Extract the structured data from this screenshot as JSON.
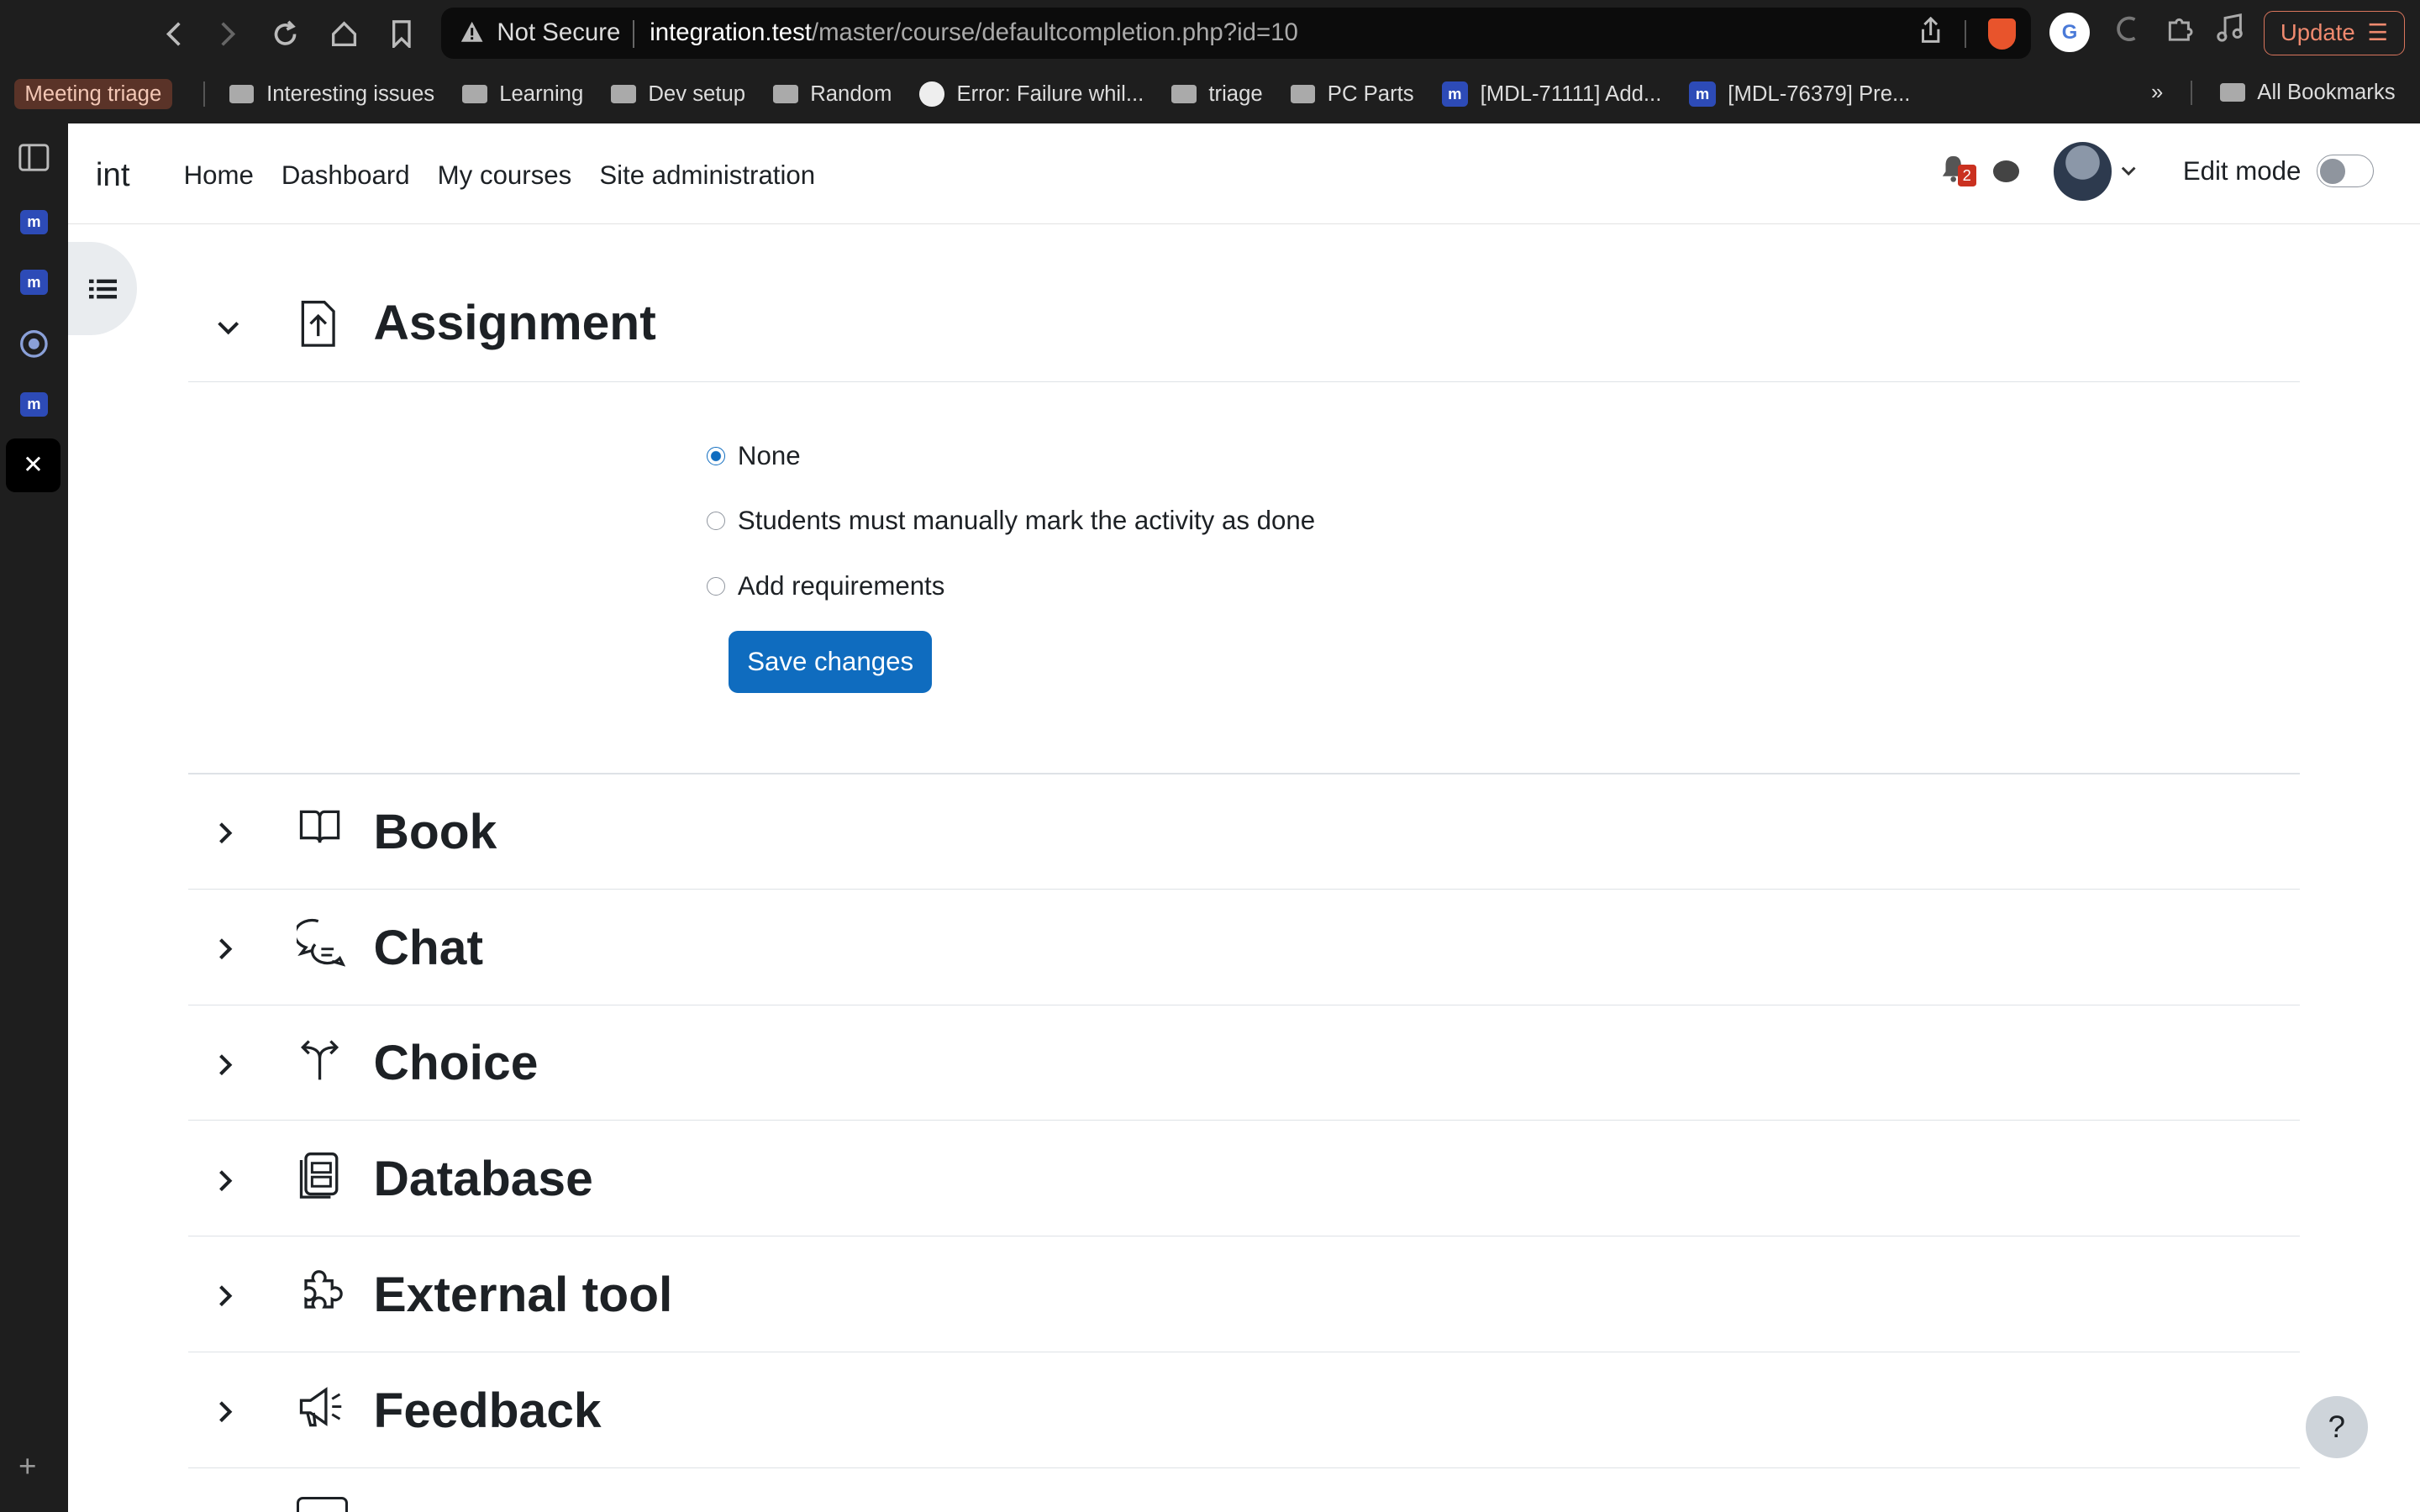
{
  "browser": {
    "url_warning": "Not Secure",
    "url_host": "integration.test",
    "url_path": "/master/course/defaultcompletion.php?id=10",
    "update_label": "Update"
  },
  "bookmarks": {
    "meeting": "Meeting triage",
    "items": [
      {
        "label": "Interesting issues",
        "icon": "folder-icon"
      },
      {
        "label": "Learning",
        "icon": "folder-icon"
      },
      {
        "label": "Dev setup",
        "icon": "folder-icon"
      },
      {
        "label": "Random",
        "icon": "folder-icon"
      },
      {
        "label": "Error: Failure whil...",
        "icon": "github-icon"
      },
      {
        "label": "triage",
        "icon": "folder-icon"
      },
      {
        "label": "PC Parts",
        "icon": "folder-icon"
      },
      {
        "label": "[MDL-71111] Add...",
        "icon": "moodle-icon"
      },
      {
        "label": "[MDL-76379] Pre...",
        "icon": "moodle-icon"
      }
    ],
    "overflow": "»",
    "all_bookmarks": "All Bookmarks"
  },
  "site": {
    "brand": "int",
    "nav": [
      "Home",
      "Dashboard",
      "My courses",
      "Site administration"
    ],
    "notifications_count": "2",
    "edit_mode": "Edit mode"
  },
  "assignment": {
    "title": "Assignment",
    "options": [
      {
        "label": "None",
        "checked": true
      },
      {
        "label": "Students must manually mark the activity as done",
        "checked": false
      },
      {
        "label": "Add requirements",
        "checked": false
      }
    ],
    "save_label": "Save changes"
  },
  "sections": [
    {
      "title": "Book",
      "icon": "book-icon"
    },
    {
      "title": "Chat",
      "icon": "chat-icon"
    },
    {
      "title": "Choice",
      "icon": "choice-icon"
    },
    {
      "title": "Database",
      "icon": "database-icon"
    },
    {
      "title": "External tool",
      "icon": "puzzle-icon"
    },
    {
      "title": "Feedback",
      "icon": "megaphone-icon"
    }
  ],
  "help_label": "?",
  "colors": {
    "primary": "#0f6cbf",
    "badge": "#ca3120"
  }
}
